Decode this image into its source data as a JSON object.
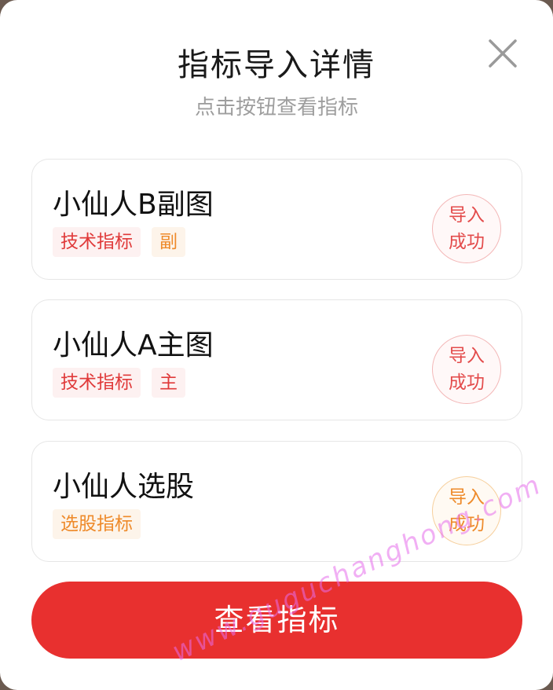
{
  "dialog": {
    "title": "指标导入详情",
    "subtitle": "点击按钮查看指标",
    "close_icon": "close-icon"
  },
  "cards": [
    {
      "name": "小仙人B副图",
      "tags": [
        {
          "label": "技术指标",
          "color": "red"
        },
        {
          "label": "副",
          "color": "orange"
        }
      ],
      "status": {
        "line1": "导入",
        "line2": "成功",
        "color": "red"
      }
    },
    {
      "name": "小仙人A主图",
      "tags": [
        {
          "label": "技术指标",
          "color": "red"
        },
        {
          "label": "主",
          "color": "red"
        }
      ],
      "status": {
        "line1": "导入",
        "line2": "成功",
        "color": "red"
      }
    },
    {
      "name": "小仙人选股",
      "tags": [
        {
          "label": "选股指标",
          "color": "orange"
        }
      ],
      "status": {
        "line1": "导入",
        "line2": "成功",
        "color": "orange"
      }
    }
  ],
  "cta": {
    "label": "查看指标"
  },
  "watermark": "www.guguchanghong.com",
  "colors": {
    "accent": "#e8302f",
    "tag_red": "#e03a3a",
    "tag_orange": "#ee8a2a"
  }
}
